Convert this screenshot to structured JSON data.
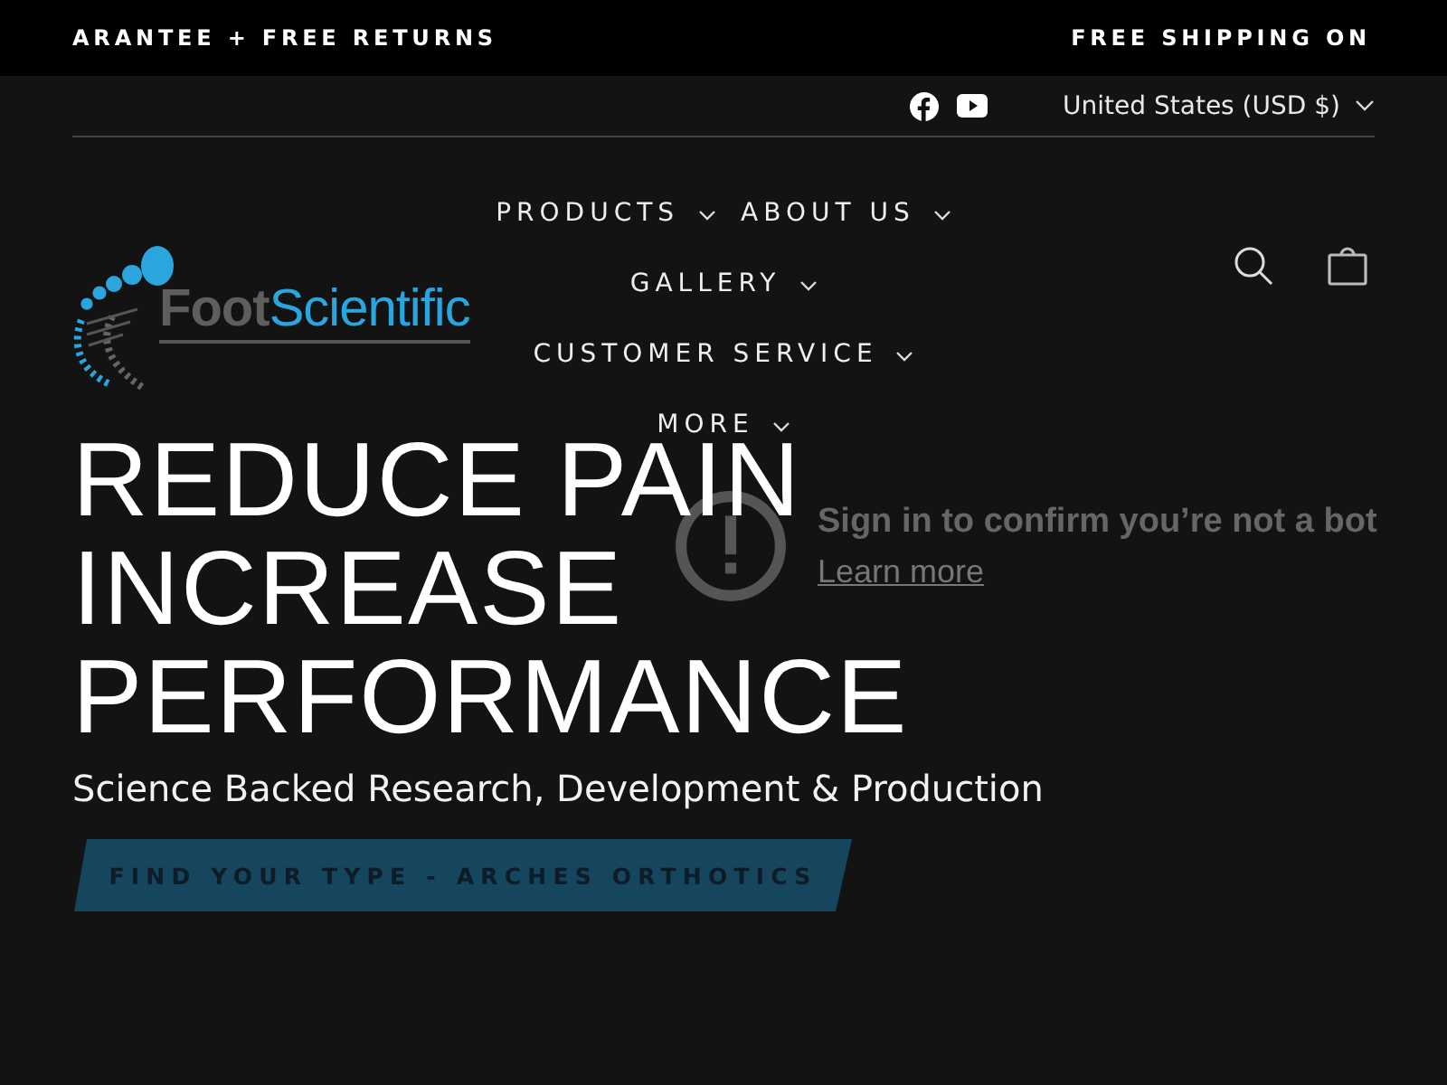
{
  "announcement_bar": {
    "messages": [
      "ARANTEE + FREE RETURNS",
      "FREE SHIPPING ON"
    ]
  },
  "utility_bar": {
    "social_links": [
      {
        "kind": "facebook"
      },
      {
        "kind": "youtube"
      }
    ],
    "currency": "United States (USD $)"
  },
  "header": {
    "logo": {
      "word_1": "Foot",
      "word_2": "Scientific"
    },
    "nav": [
      {
        "label": "PRODUCTS",
        "has_dropdown": true
      },
      {
        "label": "ABOUT US",
        "has_dropdown": true
      },
      {
        "label": "GALLERY",
        "has_dropdown": true
      },
      {
        "label": "CUSTOMER SERVICE",
        "has_dropdown": true
      },
      {
        "label": "MORE",
        "has_dropdown": true
      }
    ]
  },
  "video_notice": {
    "title": "Sign in to confirm you’re not a bot",
    "link": "Learn more"
  },
  "hero": {
    "heading_lines": [
      "REDUCE PAIN",
      "INCREASE",
      "PERFORMANCE"
    ],
    "subtitle": "Science Backed Research, Development & Production",
    "button": "FIND YOUR TYPE - ARCHES ORTHOTICS"
  }
}
